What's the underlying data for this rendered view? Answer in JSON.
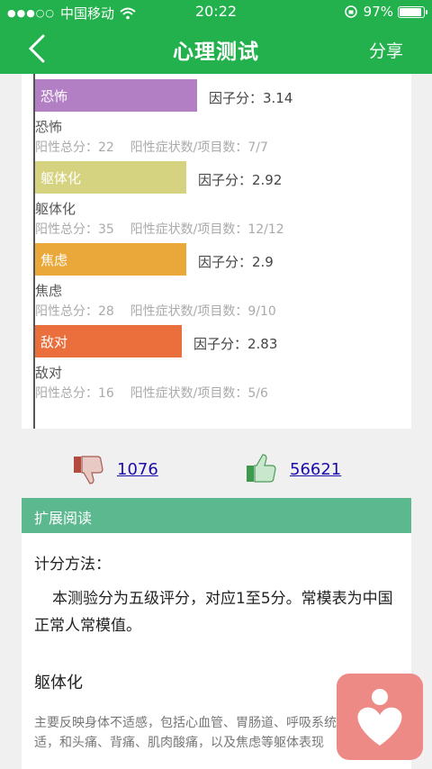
{
  "status": {
    "carrier": "中国移动",
    "time": "20:22",
    "battery": "97%"
  },
  "nav": {
    "title": "心理测试",
    "share": "分享"
  },
  "factors": [
    {
      "name": "恐怖",
      "score_label": "因子分：3.14",
      "score": 3.14,
      "stats": "阳性总分：22    阳性症状数/项目数：7/7",
      "color": "#b27fc4"
    },
    {
      "name": "躯体化",
      "score_label": "因子分：2.92",
      "score": 2.92,
      "stats": "阳性总分：35    阳性症状数/项目数：12/12",
      "color": "#d5d37f"
    },
    {
      "name": "焦虑",
      "score_label": "因子分：2.9",
      "score": 2.9,
      "stats": "阳性总分：28    阳性症状数/项目数：9/10",
      "color": "#eba83a"
    },
    {
      "name": "敌对",
      "score_label": "因子分：2.83",
      "score": 2.83,
      "stats": "阳性总分：16    阳性症状数/项目数：5/6",
      "color": "#ea6f3c"
    }
  ],
  "votes": {
    "dislike": "1076",
    "like": "56621"
  },
  "extended": {
    "header": "扩展阅读",
    "scoring_title": "计分方法：",
    "scoring_text": "本测验分为五级评分，对应1至5分。常模表为中国正常人常模值。",
    "section_title": "躯体化",
    "section_text": "主要反映身体不适感，包括心血管、胃肠道、呼吸系统的不适，和头痛、背痛、肌肉酸痛，以及焦虑等躯体表现"
  },
  "colors": {
    "brand": "#22b14c",
    "ext_header": "#5cb88f"
  }
}
